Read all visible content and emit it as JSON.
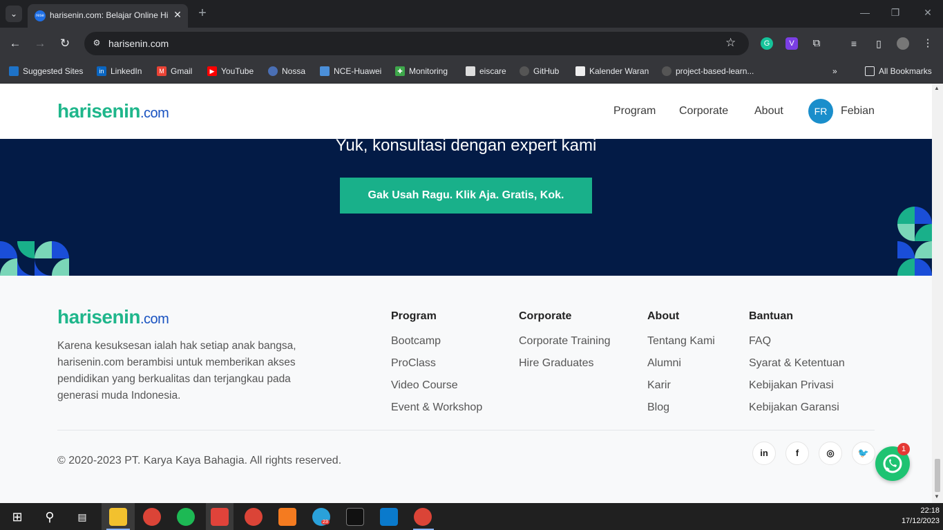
{
  "browser": {
    "tab_title": "harisenin.com: Belajar Online Hi",
    "tab_favicon_text": "rese",
    "url": "harisenin.com",
    "bookmarks": [
      {
        "label": "Suggested Sites",
        "icon": "suggested-sites-icon"
      },
      {
        "label": "LinkedIn",
        "icon": "linkedin-icon"
      },
      {
        "label": "Gmail",
        "icon": "gmail-icon"
      },
      {
        "label": "YouTube",
        "icon": "youtube-icon"
      },
      {
        "label": "Nossa",
        "icon": "nossa-icon"
      },
      {
        "label": "NCE-Huawei",
        "icon": "nce-huawei-icon"
      },
      {
        "label": "Monitoring",
        "icon": "monitoring-icon"
      },
      {
        "label": "eiscare",
        "icon": "eiscare-icon"
      },
      {
        "label": "GitHub",
        "icon": "github-icon"
      },
      {
        "label": "Kalender Waran",
        "icon": "kalender-icon"
      },
      {
        "label": "project-based-learn...",
        "icon": "github-icon"
      }
    ],
    "all_bookmarks": "All Bookmarks"
  },
  "site": {
    "logo_main": "harisenin",
    "logo_suffix": ".com",
    "nav": [
      "Program",
      "Corporate",
      "About"
    ],
    "user_initials": "FR",
    "user_name": "Febian"
  },
  "hero": {
    "heading": "Yuk, konsultasi dengan expert kami",
    "cta": "Gak Usah Ragu. Klik Aja. Gratis, Kok."
  },
  "footer": {
    "about": "Karena kesuksesan ialah hak setiap anak bangsa, harisenin.com berambisi untuk memberikan akses pendidikan yang berkualitas dan terjangkau pada generasi muda Indonesia.",
    "columns": [
      {
        "title": "Program",
        "links": [
          "Bootcamp",
          "ProClass",
          "Video Course",
          "Event & Workshop"
        ]
      },
      {
        "title": "Corporate",
        "links": [
          "Corporate Training",
          "Hire Graduates"
        ]
      },
      {
        "title": "About",
        "links": [
          "Tentang Kami",
          "Alumni",
          "Karir",
          "Blog"
        ]
      },
      {
        "title": "Bantuan",
        "links": [
          "FAQ",
          "Syarat & Ketentuan",
          "Kebijakan Privasi",
          "Kebijakan Garansi"
        ]
      }
    ],
    "copyright": "© 2020-2023 PT. Karya Kaya Bahagia. All rights reserved.",
    "social": [
      "in",
      "f",
      "◎",
      "🐦"
    ],
    "whatsapp_badge": "1"
  },
  "taskbar": {
    "time": "22:18",
    "date": "17/12/2023",
    "telegram_badge": "23"
  },
  "colors": {
    "brand_green": "#1fb68b",
    "brand_blue": "#1751c0",
    "hero_bg": "#031b46",
    "cta_bg": "#19b08a"
  }
}
